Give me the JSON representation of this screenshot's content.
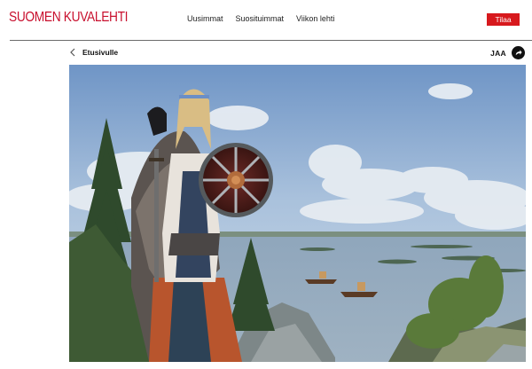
{
  "header": {
    "logo": "SUOMEN KUVALEHTI",
    "nav": [
      "Uusimmat",
      "Suosituimmat",
      "Viikon lehti"
    ],
    "subscribe_label": "Tilaa"
  },
  "article": {
    "back_label": "Etusivulle",
    "share_label": "JAA"
  },
  "colors": {
    "brand": "#c8102e",
    "subscribe_bg": "#d7191d"
  },
  "icons": {
    "back": "chevron-left-icon",
    "share": "share-arrow-icon"
  }
}
